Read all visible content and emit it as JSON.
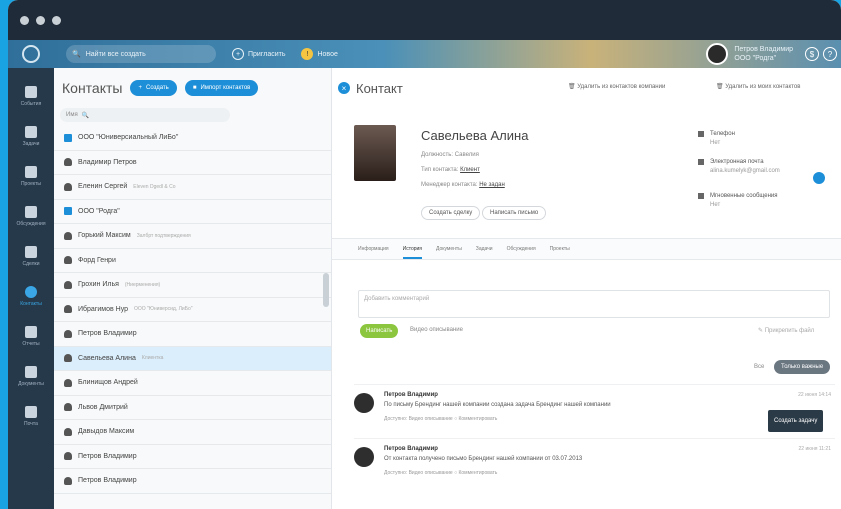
{
  "topbar": {
    "search_placeholder": "Найти все создать",
    "invite": "Пригласить",
    "new_label": "Новое",
    "user_name": "Петров Владимир",
    "user_org": "ООО \"Родга\""
  },
  "sidebar": {
    "items": [
      {
        "label": "События",
        "icon": "calendar-icon"
      },
      {
        "label": "Задачи",
        "icon": "check-icon"
      },
      {
        "label": "Проекты",
        "icon": "briefcase-icon"
      },
      {
        "label": "Обсуждения",
        "icon": "chat-icon"
      },
      {
        "label": "Сделки",
        "icon": "flask-icon"
      },
      {
        "label": "Контакты",
        "icon": "person-icon",
        "active": true
      },
      {
        "label": "Отчеты",
        "icon": "grid-icon"
      },
      {
        "label": "Документы",
        "icon": "doc-icon"
      },
      {
        "label": "Почта",
        "icon": "mail-icon"
      }
    ]
  },
  "contacts": {
    "title": "Контакты",
    "create": "Создать",
    "import": "Импорт контактов",
    "filter": "Имя",
    "rows": [
      {
        "name": "ООО \"Юниверсиальный ЛиБо\"",
        "type": "company",
        "sub": ""
      },
      {
        "name": "Владимир Петров",
        "type": "person",
        "sub": ""
      },
      {
        "name": "Еленин Сергей",
        "type": "person",
        "sub": "Eleven Dgedl & Co"
      },
      {
        "name": "ООО \"Родга\"",
        "type": "company",
        "sub": ""
      },
      {
        "name": "Горький Максим",
        "type": "person",
        "sub": "Залбрт подтверждения"
      },
      {
        "name": "Форд Генри",
        "type": "person",
        "sub": ""
      },
      {
        "name": "Грохин Илья",
        "type": "person",
        "sub": "(Ниерменения)"
      },
      {
        "name": "Ибрагимов Нур",
        "type": "person",
        "sub": "ООО \"Юниверсид, ЛиБо\""
      },
      {
        "name": "Петров Владимир",
        "type": "person",
        "sub": ""
      },
      {
        "name": "Савельева Алина",
        "type": "person",
        "sub": "Клиентка",
        "selected": true
      },
      {
        "name": "Блинищов Андрей",
        "type": "person",
        "sub": ""
      },
      {
        "name": "Львов Дмитрий",
        "type": "person",
        "sub": ""
      },
      {
        "name": "Давыдов Максим",
        "type": "person",
        "sub": ""
      },
      {
        "name": "Петров Владимир",
        "type": "person",
        "sub": ""
      },
      {
        "name": "Петров Владимир",
        "type": "person",
        "sub": ""
      }
    ]
  },
  "contact": {
    "title": "Контакт",
    "delete_company": "Удалить из контактов компании",
    "delete_my": "Удалить из моих контактов",
    "name": "Савельева Алина",
    "position_label": "Должность:",
    "position": "Савелия",
    "type_label": "Тип контакта:",
    "type": "Клиент",
    "manager_label": "Менеджер контакта:",
    "manager": "Не задан",
    "btn_deal": "Создать сделку",
    "btn_letter": "Написать письмо",
    "phone_label": "Телефон",
    "phone": "Нет",
    "email_label": "Электронная почта",
    "email": "alina.kumelyk@gmail.com",
    "im_label": "Мгновенные сообщения",
    "im": "Нет"
  },
  "tabs": [
    "Информация",
    "История",
    "Документы",
    "Задачи",
    "Обсуждения",
    "Проекты"
  ],
  "comment": {
    "placeholder": "Добавить комментарий",
    "send": "Написать",
    "history": "Видео описывание",
    "attach": "Прикрепить файл"
  },
  "filter": {
    "all": "Все",
    "important": "Только важные"
  },
  "feed": [
    {
      "author": "Петров Владимир",
      "text": "По письму Брендинг нашей компании создана задача Брендинг нашей компании",
      "date": "22 июня 14:14",
      "links": "Доступно: Видео описывание   ○ Комментировать"
    },
    {
      "author": "Петров Владимир",
      "text": "От контакта получено письмо Брендинг нашей компании от 03.07.2013",
      "date": "22 июня 11:21",
      "links": "Доступно: Видео описывание   ○ Комментировать"
    }
  ],
  "tooltip": "Создать задачу"
}
